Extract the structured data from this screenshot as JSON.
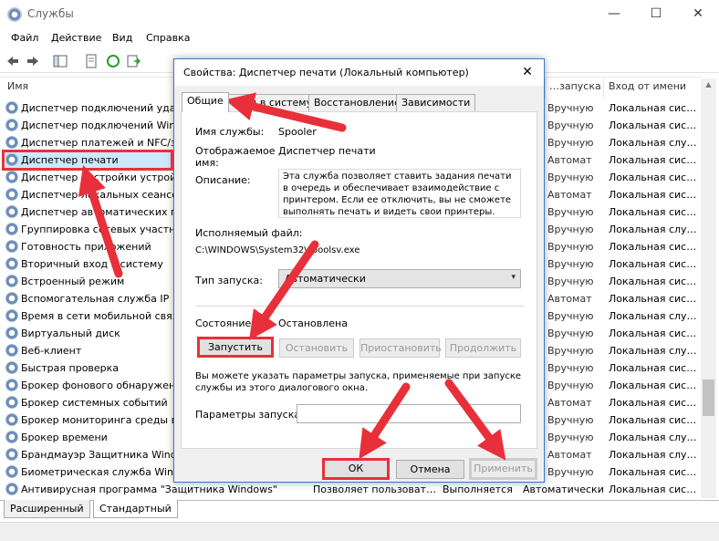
{
  "window": {
    "title": "Службы",
    "menu": [
      "Файл",
      "Действие",
      "Вид",
      "Справка"
    ],
    "controls": {
      "minimize": "—",
      "maximize": "☐",
      "close": "✕"
    }
  },
  "columns": {
    "name": "Имя",
    "startup": "…запуска",
    "logon": "Вход от имени"
  },
  "services": [
    {
      "name": "Диспетчер подключений удал",
      "logon": "Локальная сис…"
    },
    {
      "name": "Диспетчер подключений Wind",
      "logon": "Локальная сис…"
    },
    {
      "name": "Диспетчер платежей и NFC/защ",
      "logon": "Локальная слу…"
    },
    {
      "name": "Диспетчер печати",
      "logon": "Локальная сис…"
    },
    {
      "name": "Диспетчер настройки устрой",
      "logon": "Локальная сис…"
    },
    {
      "name": "Диспетчер локальных сеансо",
      "logon": "Локальная сис…"
    },
    {
      "name": "Диспетчер автоматических п",
      "logon": "Локальная сис…"
    },
    {
      "name": "Группировка сетевых участни",
      "logon": "Локальная слу…"
    },
    {
      "name": "Готовность приложений",
      "logon": "Локальная сис…"
    },
    {
      "name": "Вторичный вход в систему",
      "logon": "Локальная сис…"
    },
    {
      "name": "Встроенный режим",
      "logon": "Локальная сис…"
    },
    {
      "name": "Вспомогательная служба IP",
      "logon": "Локальная сис…"
    },
    {
      "name": "Время в сети мобильной связ",
      "logon": "Локальная слу…"
    },
    {
      "name": "Виртуальный диск",
      "logon": "Локальная сис…"
    },
    {
      "name": "Веб-клиент",
      "logon": "Локальная слу…"
    },
    {
      "name": "Быстрая проверка",
      "logon": "Локальная сис…"
    },
    {
      "name": "Брокер фонового обнаружен",
      "logon": "Локальная сис…"
    },
    {
      "name": "Брокер системных событий",
      "logon": "Локальная сис…"
    },
    {
      "name": "Брокер мониторинга среды вы",
      "logon": "Локальная сис…"
    },
    {
      "name": "Брокер времени",
      "logon": "Локальная слу…"
    },
    {
      "name": "Брандмауэр Защитника Windo",
      "logon": "Локальная слу…"
    },
    {
      "name": "Биометрическая служба Windo",
      "logon": "Локальная сис…"
    },
    {
      "name": "Антивирусная программа \"Защитника Windows\"",
      "desc": "Позволяет пользоват…",
      "status": "Выполняется",
      "startup": "Автоматически",
      "logon": "Локальная сис…"
    }
  ],
  "bottom_tabs": [
    "Расширенный",
    "Стандартный"
  ],
  "dialog": {
    "title": "Свойства: Диспетчер печати (Локальный компьютер)",
    "close": "✕",
    "tabs": [
      "Общие",
      "Вход в систему",
      "Восстановление",
      "Зависимости"
    ],
    "service_name_label": "Имя службы:",
    "service_name_value": "Spooler",
    "display_name_label": "Отображаемое имя:",
    "display_name_value": "Диспетчер печати",
    "description_label": "Описание:",
    "description_value": "Эта служба позволяет ставить задания печати в очередь и обеспечивает взаимодействие с принтером. Если ее отключить, вы не сможете выполнять печать и видеть свои принтеры.",
    "exe_label": "Исполняемый файл:",
    "exe_value": "C:\\WINDOWS\\System32\\spoolsv.exe",
    "startup_type_label": "Тип запуска:",
    "startup_type_value": "Автоматически",
    "status_label": "Состояние:",
    "status_value": "Остановлена",
    "btn_start": "Запустить",
    "btn_stop": "Остановить",
    "btn_pause": "Приостановить",
    "btn_resume": "Продолжить",
    "hint": "Вы можете указать параметры запуска, применяемые при запуске службы из этого диалогового окна.",
    "params_label": "Параметры запуска:",
    "params_value": "",
    "btn_ok": "ОК",
    "btn_cancel": "Отмена",
    "btn_apply": "Применить"
  },
  "colors": {
    "highlight": "#e8303a",
    "accent": "#3b79c7"
  }
}
